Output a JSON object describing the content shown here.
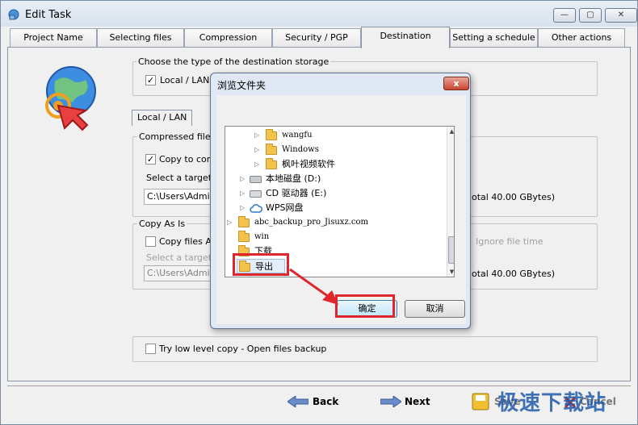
{
  "window": {
    "title": "Edit Task",
    "minimize": "—",
    "maximize": "▢",
    "close": "✕"
  },
  "tabs": [
    {
      "label": "Project Name"
    },
    {
      "label": "Selecting files"
    },
    {
      "label": "Compression"
    },
    {
      "label": "Security / PGP"
    },
    {
      "label": "Destination"
    },
    {
      "label": "Setting a schedule"
    },
    {
      "label": "Other actions"
    }
  ],
  "destination": {
    "storage_group": "Choose the type of the destination storage",
    "storage_type_label": "Local / LAN",
    "subtab": "Local / LAN",
    "compressed_group": "Compressed files",
    "copy_compressed_label": "Copy to comp",
    "select_target_label": "Select a target di",
    "compressed_path": "C:\\Users\\Admini",
    "compressed_total": "otal 40.00 GBytes)",
    "copy_as_is_group": "Copy As Is",
    "copy_as_is_label": "Copy files As I",
    "select_target_label2": "Select a target di",
    "as_is_path": "C:\\Users\\Admini",
    "ignore_file_time": "Ignore file time",
    "as_is_total": "otal 40.00 GBytes)",
    "low_level_copy": "Try low level copy - Open files backup"
  },
  "footer": {
    "back": "Back",
    "next": "Next",
    "save": "Save",
    "cancel": "Cancel"
  },
  "dialog": {
    "title": "浏览文件夹",
    "close": "x",
    "tree": [
      {
        "label": "wangfu"
      },
      {
        "label": "Windows"
      },
      {
        "label": "枫叶视频软件"
      },
      {
        "label": "本地磁盘 (D:)"
      },
      {
        "label": "CD 驱动器 (E:)"
      },
      {
        "label": "WPS网盘"
      },
      {
        "label": "abc_backup_pro_Jisuxz.com"
      },
      {
        "label": "win"
      },
      {
        "label": "下载"
      },
      {
        "label": "导出"
      }
    ],
    "ok": "确定",
    "cancel": "取消"
  },
  "watermark": "极速下载站",
  "colors": {
    "highlight": "#e0262a",
    "accent": "#3c7fb1"
  }
}
